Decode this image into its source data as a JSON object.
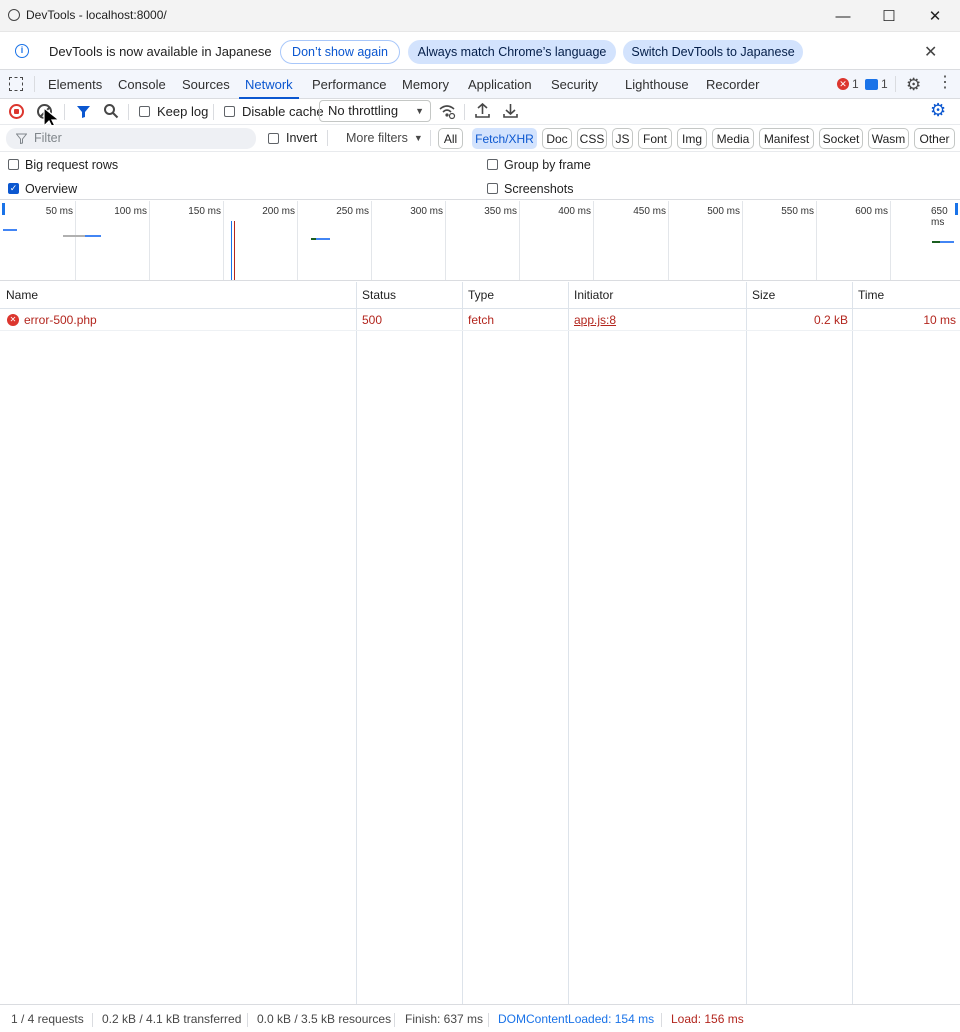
{
  "window": {
    "title": "DevTools - localhost:8000/",
    "minimize": "—",
    "maximize": "☐",
    "close": "✕"
  },
  "infobar": {
    "message": "DevTools is now available in Japanese",
    "dont_show_again": "Don’t show again",
    "always_match": "Always match Chrome’s language",
    "switch_japanese": "Switch DevTools to Japanese"
  },
  "tabs": [
    "Elements",
    "Console",
    "Sources",
    "Network",
    "Performance",
    "Memory",
    "Application",
    "Security",
    "Lighthouse",
    "Recorder"
  ],
  "active_tab": "Network",
  "badges": {
    "errors": "1",
    "messages": "1"
  },
  "toolbar": {
    "keep_log": "Keep log",
    "disable_cache": "Disable cache",
    "throttling": "No throttling"
  },
  "filter": {
    "placeholder": "Filter",
    "invert": "Invert",
    "more_filters": "More filters",
    "types": [
      "All",
      "Fetch/XHR",
      "Doc",
      "CSS",
      "JS",
      "Font",
      "Img",
      "Media",
      "Manifest",
      "Socket",
      "Wasm",
      "Other"
    ],
    "active_type": "Fetch/XHR"
  },
  "settings": {
    "big_request_rows": "Big request rows",
    "group_by_frame": "Group by frame",
    "overview": "Overview",
    "screenshots": "Screenshots",
    "overview_checked": true
  },
  "overview_ticks": [
    "50 ms",
    "100 ms",
    "150 ms",
    "200 ms",
    "250 ms",
    "300 ms",
    "350 ms",
    "400 ms",
    "450 ms",
    "500 ms",
    "550 ms",
    "600 ms",
    "650 ms"
  ],
  "table": {
    "headers": [
      "Name",
      "Status",
      "Type",
      "Initiator",
      "Size",
      "Time"
    ],
    "rows": [
      {
        "name": "error-500.php",
        "status": "500",
        "type": "fetch",
        "initiator": "app.js:8",
        "size": "0.2 kB",
        "time": "10 ms"
      }
    ]
  },
  "status": {
    "requests": "1 / 4 requests",
    "transferred": "0.2 kB / 4.1 kB transferred",
    "resources": "0.0 kB / 3.5 kB resources",
    "finish": "Finish: 637 ms",
    "dom_content_loaded": "DOMContentLoaded: 154 ms",
    "load": "Load: 156 ms"
  },
  "colors": {
    "accent": "#0b57d0",
    "error": "#b3261e",
    "dcl": "#1a73e8",
    "load": "#b3261e"
  }
}
